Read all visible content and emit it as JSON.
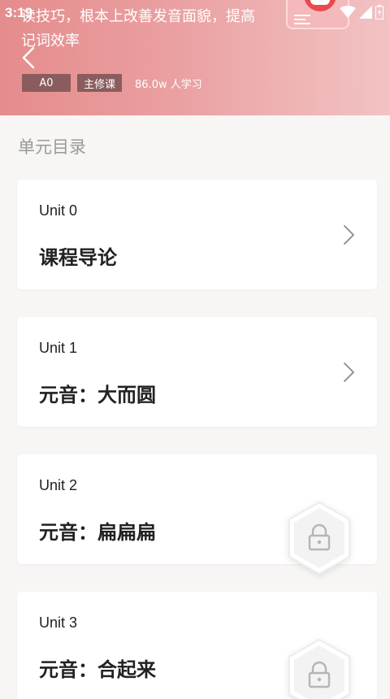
{
  "status_bar": {
    "time": "3:19"
  },
  "header": {
    "description": "读技巧，根本上改善发音面貌，提高记词效率",
    "tags": [
      "A0",
      "主修课"
    ],
    "learners": "86.0w 人学习"
  },
  "section_title": "单元目录",
  "units": [
    {
      "number": "Unit  0",
      "title": "课程导论",
      "locked": false
    },
    {
      "number": "Unit  1",
      "title": "元音：大而圆",
      "locked": false
    },
    {
      "number": "Unit  2",
      "title": "元音：扁扁扁",
      "locked": true
    },
    {
      "number": "Unit  3",
      "title": "元音：合起来",
      "locked": true
    }
  ],
  "icons": {
    "back": "chevron-left-icon",
    "open_unit": "chevron-right-icon",
    "locked_unit": "lock-icon",
    "wifi": "wifi-icon",
    "signal": "signal-icon",
    "battery": "battery-icon"
  },
  "colors": {
    "header_gradient_start": "#e58c8d",
    "header_gradient_end": "#f2c3c4",
    "tag_background": "#8a5c5d",
    "page_background": "#f7f6f5",
    "section_title": "#9a9a9a"
  }
}
